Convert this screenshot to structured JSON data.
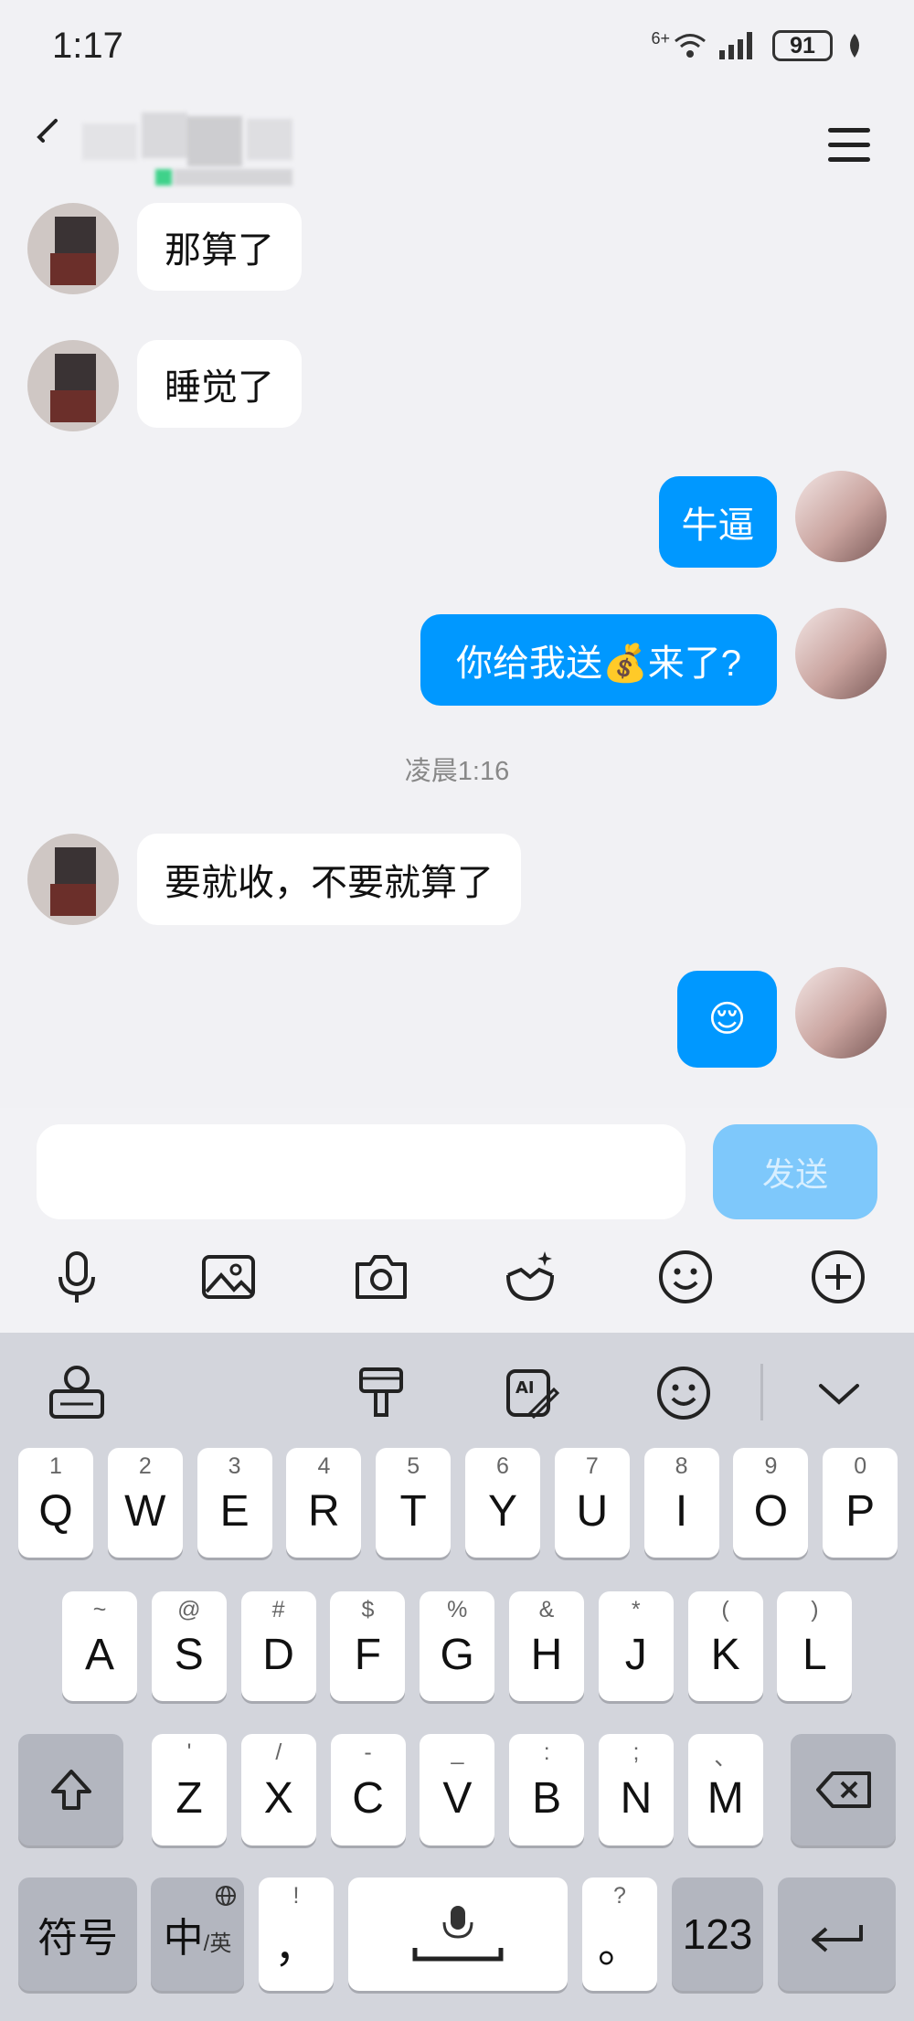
{
  "status_bar": {
    "time": "1:17",
    "battery": "91",
    "network": "6+"
  },
  "chat": {
    "messages": [
      {
        "side": "left",
        "text": "那算了"
      },
      {
        "side": "left",
        "text": "睡觉了"
      },
      {
        "side": "right",
        "text": "牛逼"
      },
      {
        "side": "right",
        "text": "你给我送💰来了?"
      },
      {
        "side": "left",
        "text": "要就收，不要就算了"
      },
      {
        "side": "right",
        "text": "😌"
      }
    ],
    "timestamp": "凌晨1:16"
  },
  "composer": {
    "placeholder": "",
    "send_label": "发送"
  },
  "toolbar": {
    "icons": [
      "microphone-icon",
      "image-icon",
      "camera-icon",
      "sticker-icon",
      "emoji-icon",
      "plus-icon"
    ]
  },
  "keyboard": {
    "row1": [
      {
        "k": "Q",
        "s": "1"
      },
      {
        "k": "W",
        "s": "2"
      },
      {
        "k": "E",
        "s": "3"
      },
      {
        "k": "R",
        "s": "4"
      },
      {
        "k": "T",
        "s": "5"
      },
      {
        "k": "Y",
        "s": "6"
      },
      {
        "k": "U",
        "s": "7"
      },
      {
        "k": "I",
        "s": "8"
      },
      {
        "k": "O",
        "s": "9"
      },
      {
        "k": "P",
        "s": "0"
      }
    ],
    "row2": [
      {
        "k": "A",
        "s": "~"
      },
      {
        "k": "S",
        "s": "@"
      },
      {
        "k": "D",
        "s": "#"
      },
      {
        "k": "F",
        "s": "$"
      },
      {
        "k": "G",
        "s": "%"
      },
      {
        "k": "H",
        "s": "&"
      },
      {
        "k": "J",
        "s": "*"
      },
      {
        "k": "K",
        "s": "("
      },
      {
        "k": "L",
        "s": ")"
      }
    ],
    "row3": [
      {
        "k": "Z",
        "s": "'"
      },
      {
        "k": "X",
        "s": "/"
      },
      {
        "k": "C",
        "s": "-"
      },
      {
        "k": "V",
        "s": "_"
      },
      {
        "k": "B",
        "s": ":"
      },
      {
        "k": "N",
        "s": ";"
      },
      {
        "k": "M",
        "s": "、"
      }
    ],
    "symbols_label": "符号",
    "lang_label": "中",
    "lang_sub": "/英",
    "comma": "，",
    "comma_sub": "!",
    "period": "。",
    "period_sub": "?",
    "num_label": "123"
  },
  "colors": {
    "accent": "#0098ff",
    "send_disabled": "#7ec8fb"
  }
}
